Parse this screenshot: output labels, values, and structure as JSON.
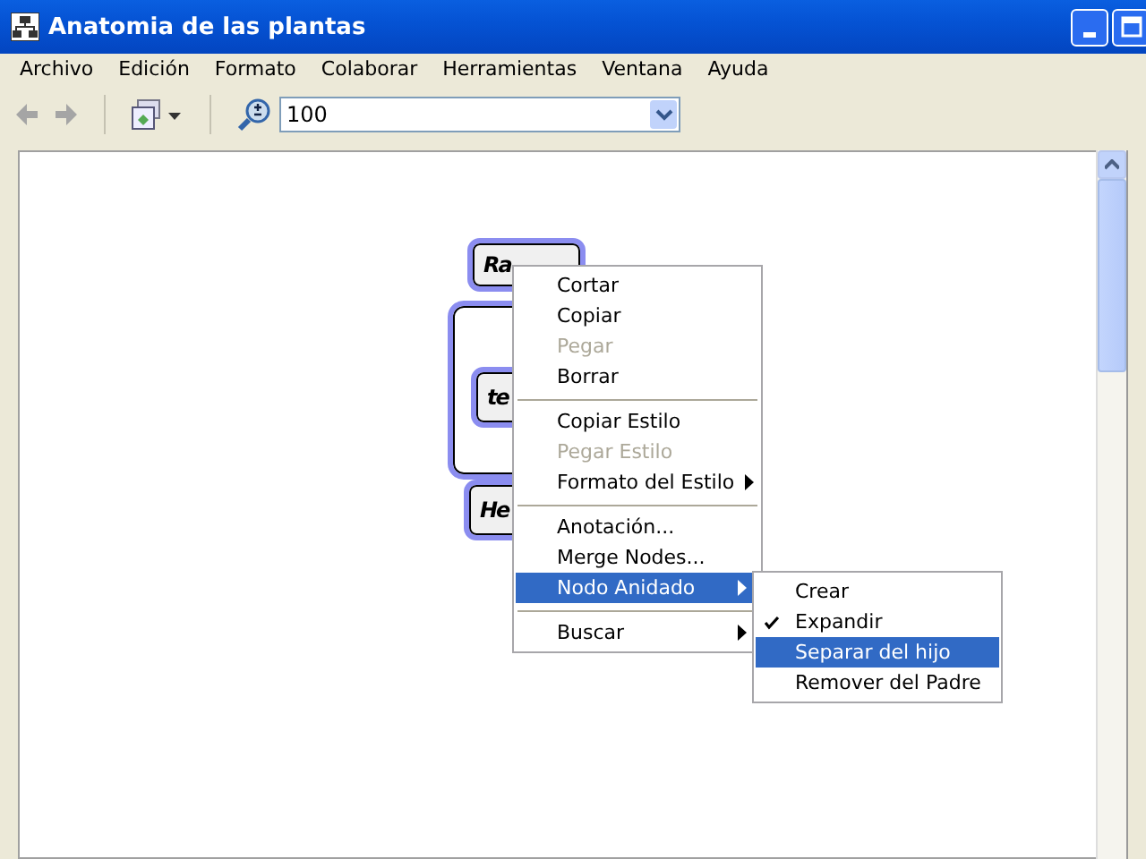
{
  "window": {
    "title": "Anatomia de las plantas"
  },
  "menu_bar": [
    "Archivo",
    "Edición",
    "Formato",
    "Colaborar",
    "Herramientas",
    "Ventana",
    "Ayuda"
  ],
  "toolbar": {
    "back_disabled": true,
    "forward_disabled": true,
    "zoom": "100"
  },
  "nodes": [
    {
      "label": "Ra",
      "kind": "node"
    },
    {
      "kind": "container"
    },
    {
      "label": "te",
      "kind": "node"
    },
    {
      "label": "He",
      "kind": "node"
    }
  ],
  "context_menu": [
    {
      "kind": "item",
      "label": "Cortar",
      "disabled": false,
      "submenu": false,
      "selected": false
    },
    {
      "kind": "item",
      "label": "Copiar",
      "disabled": false,
      "submenu": false,
      "selected": false
    },
    {
      "kind": "item",
      "label": "Pegar",
      "disabled": true,
      "submenu": false,
      "selected": false
    },
    {
      "kind": "item",
      "label": "Borrar",
      "disabled": false,
      "submenu": false,
      "selected": false
    },
    {
      "kind": "separator"
    },
    {
      "kind": "item",
      "label": "Copiar Estilo",
      "disabled": false,
      "submenu": false,
      "selected": false
    },
    {
      "kind": "item",
      "label": "Pegar Estilo",
      "disabled": true,
      "submenu": false,
      "selected": false
    },
    {
      "kind": "item",
      "label": "Formato del Estilo",
      "disabled": false,
      "submenu": true,
      "selected": false
    },
    {
      "kind": "separator"
    },
    {
      "kind": "item",
      "label": "Anotación...",
      "disabled": false,
      "submenu": false,
      "selected": false
    },
    {
      "kind": "item",
      "label": "Merge Nodes...",
      "disabled": false,
      "submenu": false,
      "selected": false
    },
    {
      "kind": "item",
      "label": "Nodo Anidado",
      "disabled": false,
      "submenu": true,
      "selected": true
    },
    {
      "kind": "separator"
    },
    {
      "kind": "item",
      "label": "Buscar",
      "disabled": false,
      "submenu": true,
      "selected": false
    }
  ],
  "submenu": [
    {
      "label": "Crear",
      "checked": false,
      "selected": false
    },
    {
      "label": "Expandir",
      "checked": true,
      "selected": false
    },
    {
      "label": "Separar del hijo",
      "checked": false,
      "selected": true
    },
    {
      "label": "Remover del Padre",
      "checked": false,
      "selected": false
    }
  ]
}
